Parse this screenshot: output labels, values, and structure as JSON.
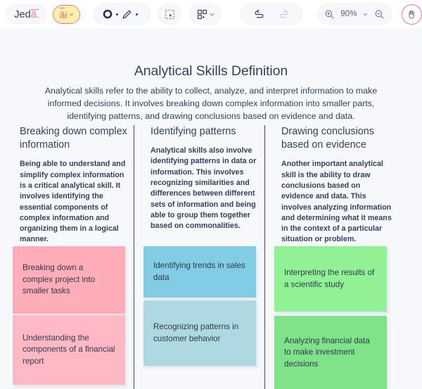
{
  "toolbar": {
    "logo": {
      "prefix": "Jed",
      "suffix": "ā."
    },
    "ai_button": {
      "label": "āi",
      "icon": "chevron-down-icon"
    },
    "tools": {
      "shape_icon": "circle-shape-icon",
      "pen_icon": "pencil-icon"
    },
    "select_tool": {
      "icon": "select-marquee-cursor-icon"
    },
    "grid_tool": {
      "icon": "grid-layout-icon",
      "chevron": "chevron-down-icon"
    },
    "history": {
      "undo_icon": "undo-arrow-icon",
      "redo_icon": "redo-arrow-icon",
      "redo_disabled": true
    },
    "zoom": {
      "in_icon": "zoom-in-icon",
      "level": "90%",
      "chevron": "chevron-down-icon",
      "out_icon": "zoom-out-icon"
    },
    "hand_tool": {
      "icon": "hand-pan-icon",
      "active": true
    }
  },
  "slide": {
    "title": "Analytical Skills Definition",
    "description": "Analytical skills refer to the ability to collect, analyze, and interpret information to make informed decisions. It involves breaking down complex information into smaller parts, identifying patterns, and drawing conclusions based on evidence and data.",
    "columns": [
      {
        "heading": "Breaking down complex information",
        "body": "Being able to understand and simplify complex information is a critical analytical skill. It involves identifying the essential components of complex information and organizing them in a logical manner.",
        "cards": [
          {
            "text": "Breaking down a complex project into smaller tasks",
            "color": "#ffadb9"
          },
          {
            "text": "Understanding the components of a financial report",
            "color": "#ffb9c5"
          }
        ]
      },
      {
        "heading": "Identifying patterns",
        "body": "Analytical skills also involve identifying patterns in data or information. This involves recognizing similarities and differences between different sets of information and being able to group them together based on commonalities.",
        "cards": [
          {
            "text": "Identifying trends in sales data",
            "color": "#82cde6"
          },
          {
            "text": "Recognizing patterns in customer behavior",
            "color": "#afd9e2"
          }
        ]
      },
      {
        "heading": "Drawing conclusions based on evidence",
        "body": "Another important analytical skill is the ability to draw conclusions based on evidence and data. This involves analyzing information and determining what it means in the context of a particular situation or problem.",
        "cards": [
          {
            "text": "Interpreting the results of a scientific study",
            "color": "#90f295"
          },
          {
            "text": "Analyzing financial data to make investment decisions",
            "color": "#7fe389"
          }
        ]
      }
    ]
  },
  "colors": {
    "canvas_background": "#f6f8fc",
    "text_primary": "#33425b",
    "accent_pink": "#ff6d92",
    "ai_yellow": "#fdf0ac"
  }
}
